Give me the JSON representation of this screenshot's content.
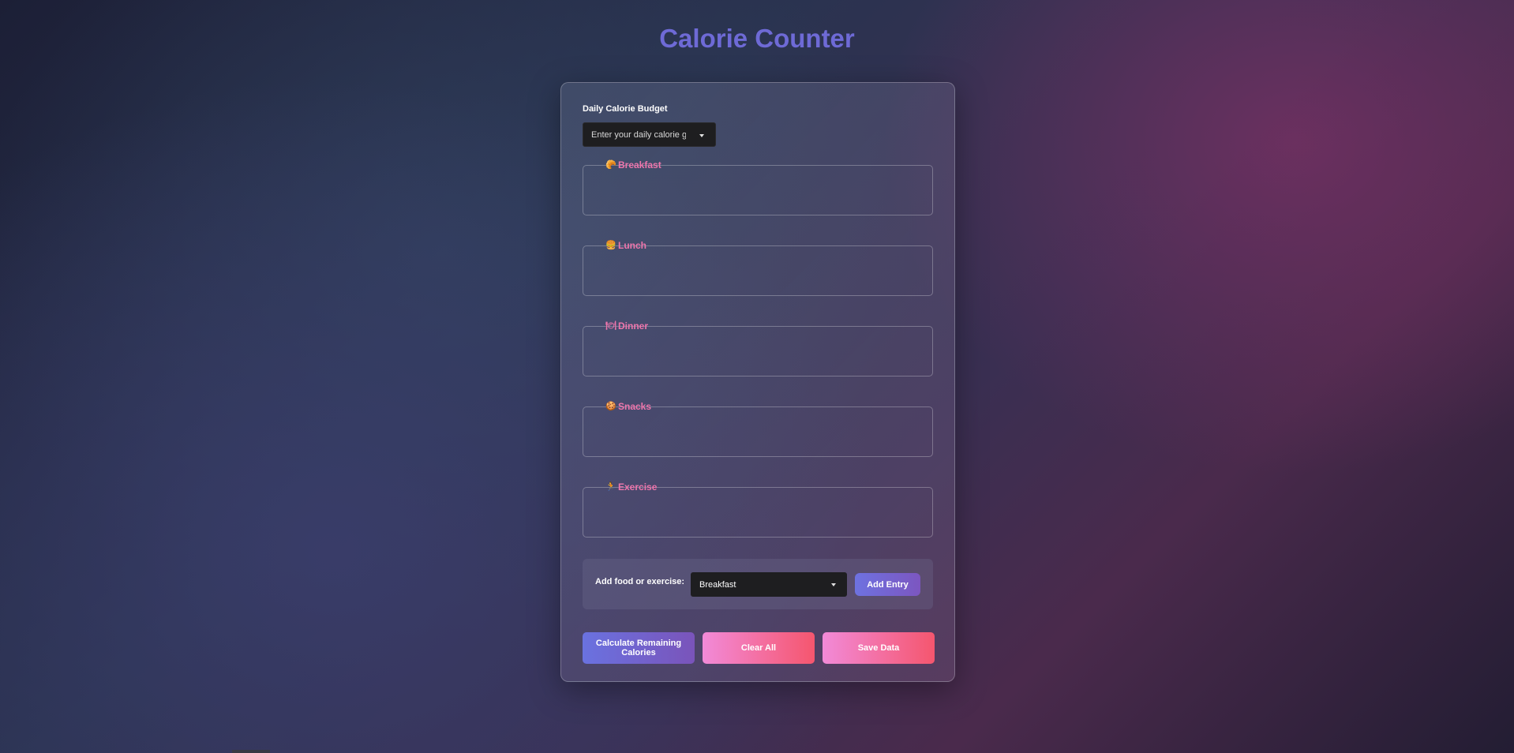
{
  "app": {
    "title": "Calorie Counter"
  },
  "budget": {
    "label": "Daily Calorie Budget",
    "placeholder": "Enter your daily calorie goal"
  },
  "meals": [
    {
      "label": "Breakfast",
      "icon": "croissant-icon",
      "glyph": "🥐"
    },
    {
      "label": "Lunch",
      "icon": "burger-icon",
      "glyph": "🍔"
    },
    {
      "label": "Dinner",
      "icon": "dinner-icon",
      "glyph": "🍽"
    },
    {
      "label": "Snacks",
      "icon": "snack-icon",
      "glyph": "🍪"
    },
    {
      "label": "Exercise",
      "icon": "running-icon",
      "glyph": "🏃"
    }
  ],
  "add_entry": {
    "label": "Add food or exercise:",
    "selected_type": "Breakfast",
    "button_label": "Add Entry"
  },
  "actions": {
    "calculate_label": "Calculate Remaining Calories",
    "clear_label": "Clear All",
    "save_label": "Save Data"
  },
  "colors": {
    "title": "#6e6ad6",
    "accent_pink": "#ee76ac",
    "primary_gradient_start": "#6a72e0",
    "primary_gradient_end": "#7a54ba",
    "danger_gradient_start": "#f28ad8",
    "danger_gradient_end": "#f5566e"
  }
}
